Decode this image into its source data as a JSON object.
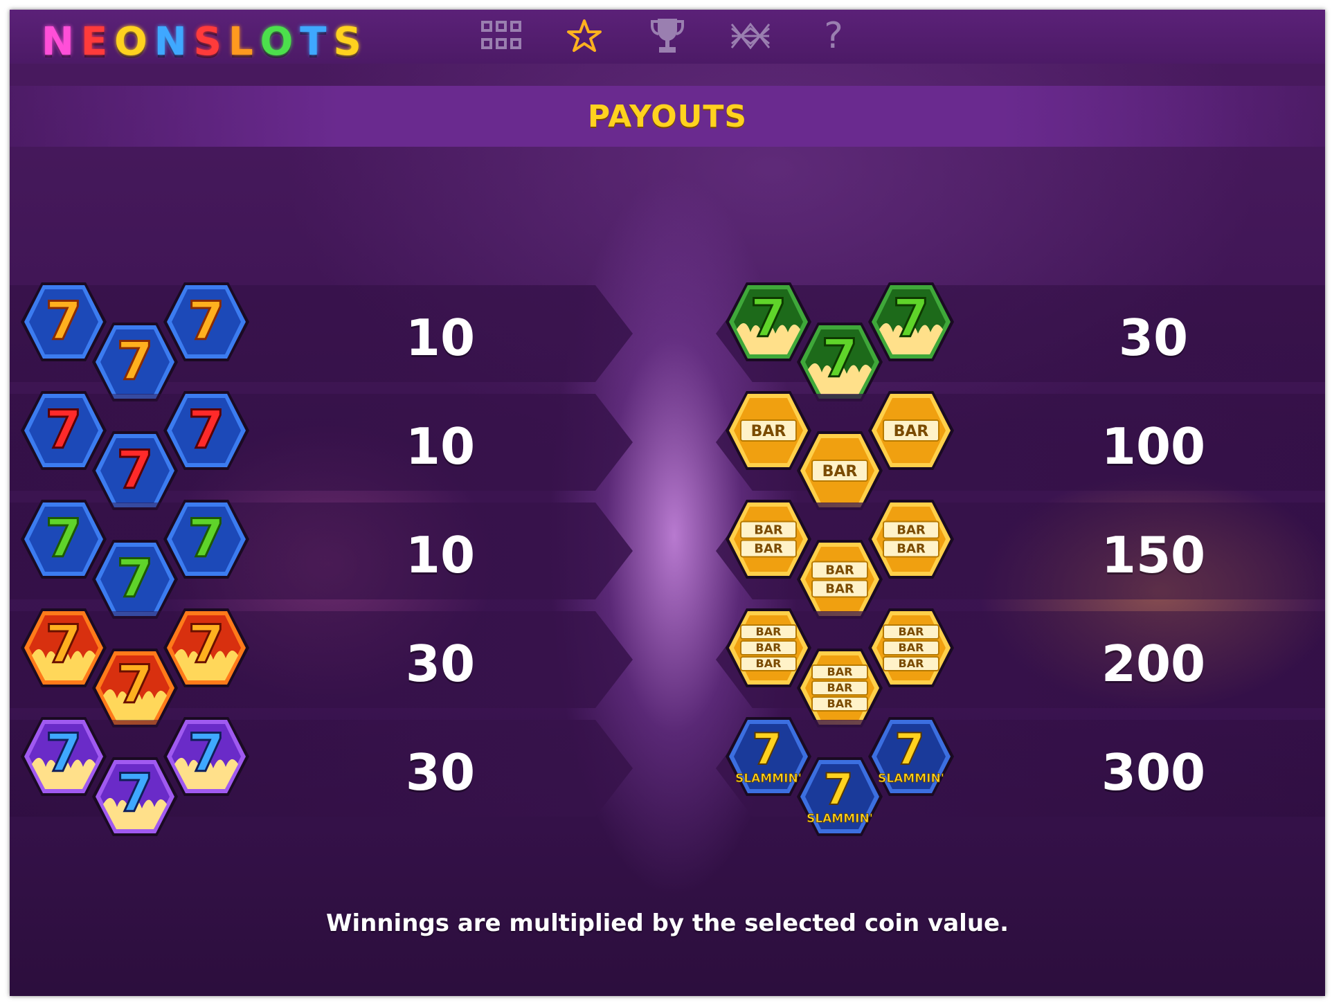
{
  "logo": {
    "letters": [
      "N",
      "E",
      "O",
      "N",
      "S",
      "L",
      "O",
      "T",
      "S"
    ],
    "colors": [
      "#ff4fd8",
      "#ff3b3b",
      "#ffd21f",
      "#3fa8ff",
      "#ff3b3b",
      "#ff9a1f",
      "#4ce04c",
      "#3fa8ff",
      "#ffd21f"
    ]
  },
  "nav": {
    "icons": [
      "grid-icon",
      "star-icon",
      "trophy-icon",
      "paylines-icon",
      "help-icon"
    ],
    "help_glyph": "?",
    "star_color": "#ffb21f",
    "icon_color": "#9a7fb0"
  },
  "banner": {
    "title": "PAYOUTS"
  },
  "payouts": {
    "left": [
      {
        "symbol": "blue-hex-orange-seven",
        "label": "7",
        "value": "10"
      },
      {
        "symbol": "blue-hex-red-seven",
        "label": "7",
        "value": "10"
      },
      {
        "symbol": "blue-hex-green-seven",
        "label": "7",
        "value": "10"
      },
      {
        "symbol": "fire-hex-red-seven",
        "label": "7",
        "value": "30"
      },
      {
        "symbol": "fire-hex-purple-seven",
        "label": "7",
        "value": "30"
      }
    ],
    "right": [
      {
        "symbol": "fire-hex-green-seven",
        "label": "7",
        "value": "30"
      },
      {
        "symbol": "gold-hex-single-bar",
        "label": "BAR",
        "value": "100"
      },
      {
        "symbol": "gold-hex-double-bar",
        "label": "BAR",
        "value": "150"
      },
      {
        "symbol": "gold-hex-triple-bar",
        "label": "BAR",
        "value": "200"
      },
      {
        "symbol": "blue-hex-slammin-seven",
        "label": "SLAMMIN'",
        "value": "300"
      }
    ]
  },
  "footer": {
    "note": "Winnings are multiplied by the selected coin value."
  }
}
